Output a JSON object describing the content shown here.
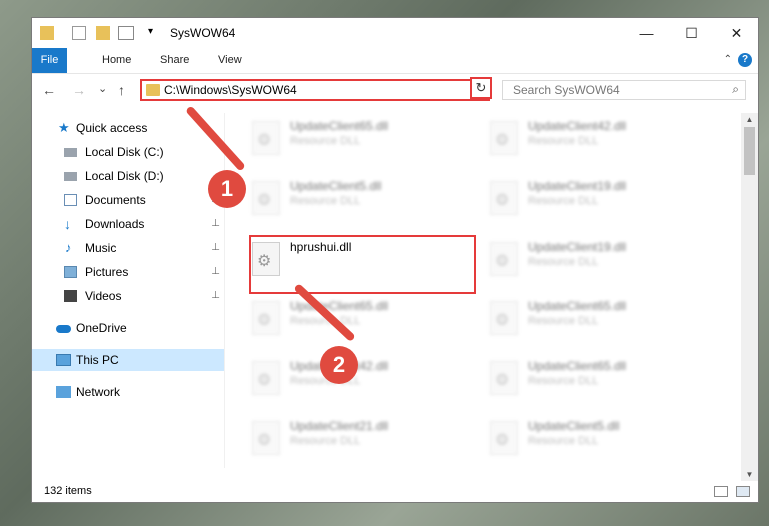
{
  "window": {
    "title": "SysWOW64",
    "minimize": "—",
    "maximize": "☐",
    "close": "✕"
  },
  "ribbon": {
    "tabs": [
      "File",
      "Home",
      "Share",
      "View"
    ],
    "help": "?",
    "collapse": "⌃"
  },
  "nav": {
    "back": "←",
    "forward": "→",
    "recent": "⌄",
    "up": "↑",
    "address": "C:\\Windows\\SysWOW64",
    "address_dropdown": "⌄",
    "refresh": "↻",
    "search_placeholder": "Search SysWOW64",
    "search_icon": "⌕"
  },
  "sidebar": {
    "items": [
      {
        "label": "Quick access",
        "icon": "star-icon",
        "pinned": false
      },
      {
        "label": "Local Disk (C:)",
        "icon": "drive-icon",
        "pinned": false
      },
      {
        "label": "Local Disk (D:)",
        "icon": "drive-icon",
        "pinned": false
      },
      {
        "label": "Documents",
        "icon": "documents-icon",
        "pinned": true
      },
      {
        "label": "Downloads",
        "icon": "download-icon",
        "pinned": true
      },
      {
        "label": "Music",
        "icon": "music-icon",
        "pinned": true
      },
      {
        "label": "Pictures",
        "icon": "pictures-icon",
        "pinned": true
      },
      {
        "label": "Videos",
        "icon": "videos-icon",
        "pinned": true
      },
      {
        "label": "OneDrive",
        "icon": "cloud-icon",
        "pinned": false
      },
      {
        "label": "This PC",
        "icon": "computer-icon",
        "pinned": false
      },
      {
        "label": "Network",
        "icon": "network-icon",
        "pinned": false
      }
    ],
    "pin_glyph": "📌"
  },
  "files": {
    "left_col": [
      {
        "name": "UpdateClient65.dll",
        "type": "Resource DLL"
      },
      {
        "name": "UpdateClient5.dll",
        "type": "Resource DLL"
      },
      {
        "name": "hprushui.dll",
        "type": ""
      },
      {
        "name": "UpdateClient65.dll",
        "type": "Resource DLL"
      },
      {
        "name": "UpdateClient42.dll",
        "type": "Resource DLL"
      },
      {
        "name": "UpdateClient21.dll",
        "type": "Resource DLL"
      }
    ],
    "right_col": [
      {
        "name": "UpdateClient42.dll",
        "type": "Resource DLL"
      },
      {
        "name": "UpdateClient19.dll",
        "type": "Resource DLL"
      },
      {
        "name": "UpdateClient19.dll",
        "type": "Resource DLL"
      },
      {
        "name": "UpdateClient65.dll",
        "type": "Resource DLL"
      },
      {
        "name": "UpdateClient65.dll",
        "type": "Resource DLL"
      },
      {
        "name": "UpdateClient5.dll",
        "type": "Resource DLL"
      }
    ]
  },
  "status": {
    "count": "132 items"
  },
  "annotations": {
    "step1": "1",
    "step2": "2"
  },
  "colors": {
    "accent": "#1979ca",
    "highlight": "#e53a3a",
    "badge": "#e04a3f",
    "selected": "#cce8ff"
  }
}
